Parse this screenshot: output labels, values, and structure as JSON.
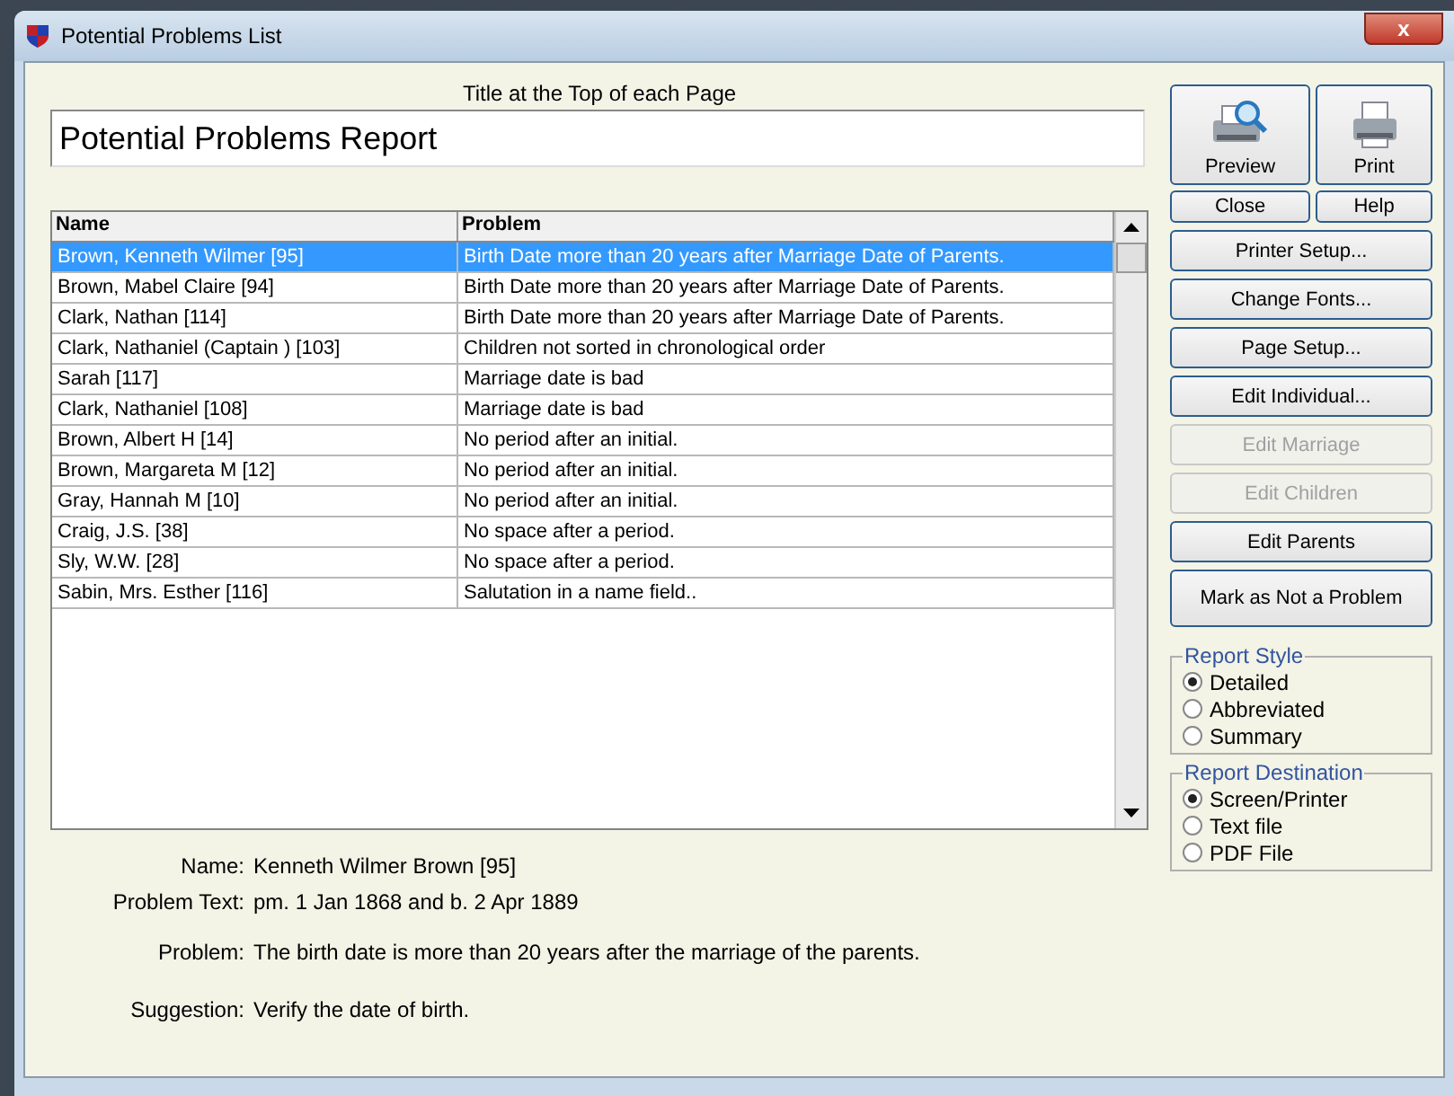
{
  "window": {
    "title": "Potential Problems List",
    "close_label": "x"
  },
  "title_field": {
    "label": "Title at the Top of each Page",
    "value": "Potential Problems Report"
  },
  "table": {
    "columns": [
      "Name",
      "Problem"
    ],
    "rows": [
      {
        "name": "Brown, Kenneth Wilmer [95]",
        "problem": "Birth Date more than 20 years after Marriage Date of Parents.",
        "selected": true
      },
      {
        "name": "Brown, Mabel Claire [94]",
        "problem": "Birth Date more than 20 years after Marriage Date of Parents.",
        "selected": false
      },
      {
        "name": "Clark, Nathan [114]",
        "problem": "Birth Date more than 20 years after Marriage Date of Parents.",
        "selected": false
      },
      {
        "name": "Clark, Nathaniel (Captain ) [103]",
        "problem": "Children not sorted in chronological order",
        "selected": false
      },
      {
        "name": "Sarah [117]",
        "problem": "Marriage date is bad",
        "selected": false
      },
      {
        "name": "Clark, Nathaniel [108]",
        "problem": "Marriage date is bad",
        "selected": false
      },
      {
        "name": "Brown, Albert H [14]",
        "problem": "No period after an initial.",
        "selected": false
      },
      {
        "name": "Brown, Margareta M [12]",
        "problem": "No period after an initial.",
        "selected": false
      },
      {
        "name": "Gray, Hannah M [10]",
        "problem": "No period after an initial.",
        "selected": false
      },
      {
        "name": "Craig, J.S. [38]",
        "problem": "No space after a period.",
        "selected": false
      },
      {
        "name": "Sly, W.W. [28]",
        "problem": "No space after a period.",
        "selected": false
      },
      {
        "name": "Sabin, Mrs. Esther [116]",
        "problem": "Salutation in a name field..",
        "selected": false
      }
    ]
  },
  "details": [
    {
      "label": "Name:",
      "value": "Kenneth Wilmer Brown [95]"
    },
    {
      "label": "Problem Text:",
      "value": "pm. 1 Jan 1868 and b. 2 Apr 1889"
    },
    {
      "label": "Problem:",
      "value": "The birth date is more than 20 years after the marriage of the parents."
    },
    {
      "label": "Suggestion:",
      "value": "Verify the date of birth."
    }
  ],
  "icon_buttons": [
    {
      "label": "Preview",
      "kind": "preview"
    },
    {
      "label": "Print",
      "kind": "print"
    }
  ],
  "small_buttons": [
    {
      "label": "Close"
    },
    {
      "label": "Help"
    }
  ],
  "buttons": [
    {
      "label": "Printer Setup...",
      "disabled": false,
      "kind": "normal"
    },
    {
      "label": "Change Fonts...",
      "disabled": false,
      "kind": "normal"
    },
    {
      "label": "Page Setup...",
      "disabled": false,
      "kind": "normal"
    },
    {
      "label": "Edit Individual...",
      "disabled": false,
      "kind": "normal"
    },
    {
      "label": "Edit Marriage",
      "disabled": true,
      "kind": "normal"
    },
    {
      "label": "Edit Children",
      "disabled": true,
      "kind": "normal"
    },
    {
      "label": "Edit Parents",
      "disabled": false,
      "kind": "normal"
    },
    {
      "label": "Mark as Not a Problem",
      "disabled": false,
      "kind": "tall"
    }
  ],
  "groups": [
    {
      "title": "Report Style",
      "options": [
        {
          "label": "Detailed",
          "selected": true
        },
        {
          "label": "Abbreviated",
          "selected": false
        },
        {
          "label": "Summary",
          "selected": false
        }
      ]
    },
    {
      "title": "Report Destination",
      "options": [
        {
          "label": "Screen/Printer",
          "selected": true
        },
        {
          "label": "Text file",
          "selected": false
        },
        {
          "label": "PDF File",
          "selected": false
        }
      ]
    }
  ]
}
